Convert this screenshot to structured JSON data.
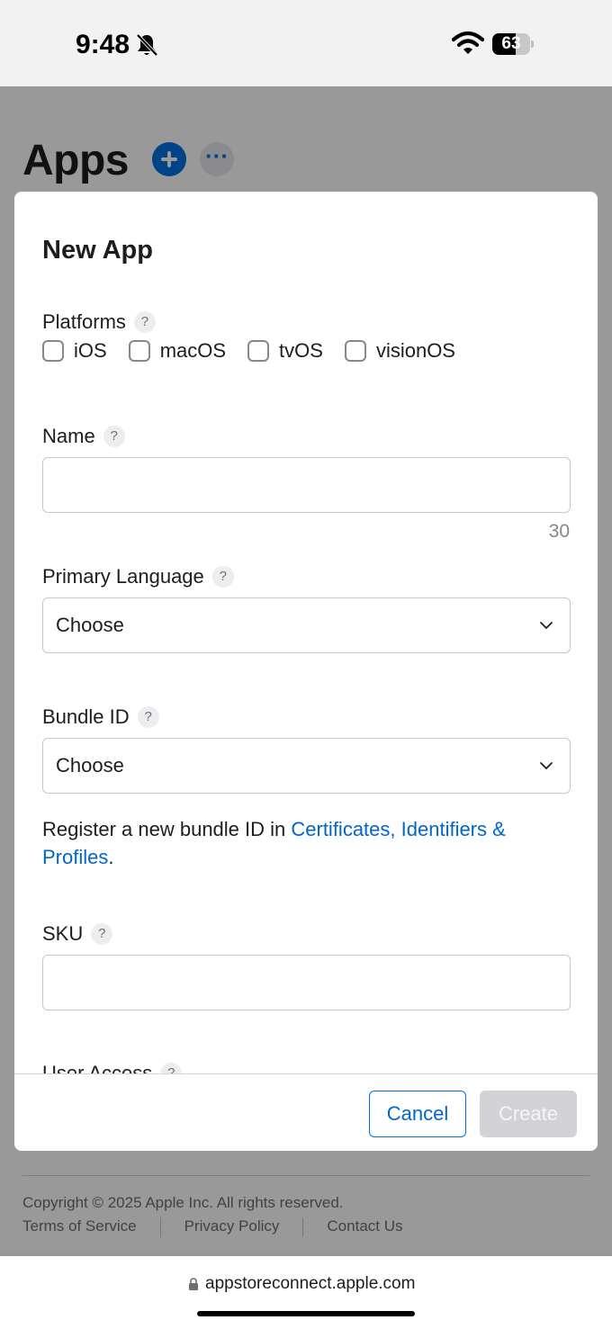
{
  "status_bar": {
    "time": "9:48",
    "battery": "63",
    "battery_level": 0.63
  },
  "page": {
    "title": "Apps",
    "copyright": "Copyright © 2025 Apple Inc. All rights reserved.",
    "footer_links": [
      "Terms of Service",
      "Privacy Policy",
      "Contact Us"
    ]
  },
  "modal": {
    "title": "New App",
    "platforms": {
      "label": "Platforms",
      "options": [
        {
          "label": "iOS",
          "checked": false
        },
        {
          "label": "macOS",
          "checked": false
        },
        {
          "label": "tvOS",
          "checked": false
        },
        {
          "label": "visionOS",
          "checked": false
        }
      ]
    },
    "name": {
      "label": "Name",
      "value": "",
      "remaining": "30"
    },
    "primary_language": {
      "label": "Primary Language",
      "selected": "Choose"
    },
    "bundle_id": {
      "label": "Bundle ID",
      "selected": "Choose",
      "hint_prefix": "Register a new bundle ID in ",
      "hint_link": "Certificates, Identifiers & Profiles",
      "hint_suffix": "."
    },
    "sku": {
      "label": "SKU",
      "value": ""
    },
    "user_access": {
      "label": "User Access"
    },
    "help_glyph": "?",
    "buttons": {
      "cancel": "Cancel",
      "create": "Create"
    }
  },
  "browser": {
    "url": "appstoreconnect.apple.com"
  },
  "colors": {
    "accent": "#0071e3",
    "link": "#0066cc",
    "disabled": "#d2d2d7"
  }
}
